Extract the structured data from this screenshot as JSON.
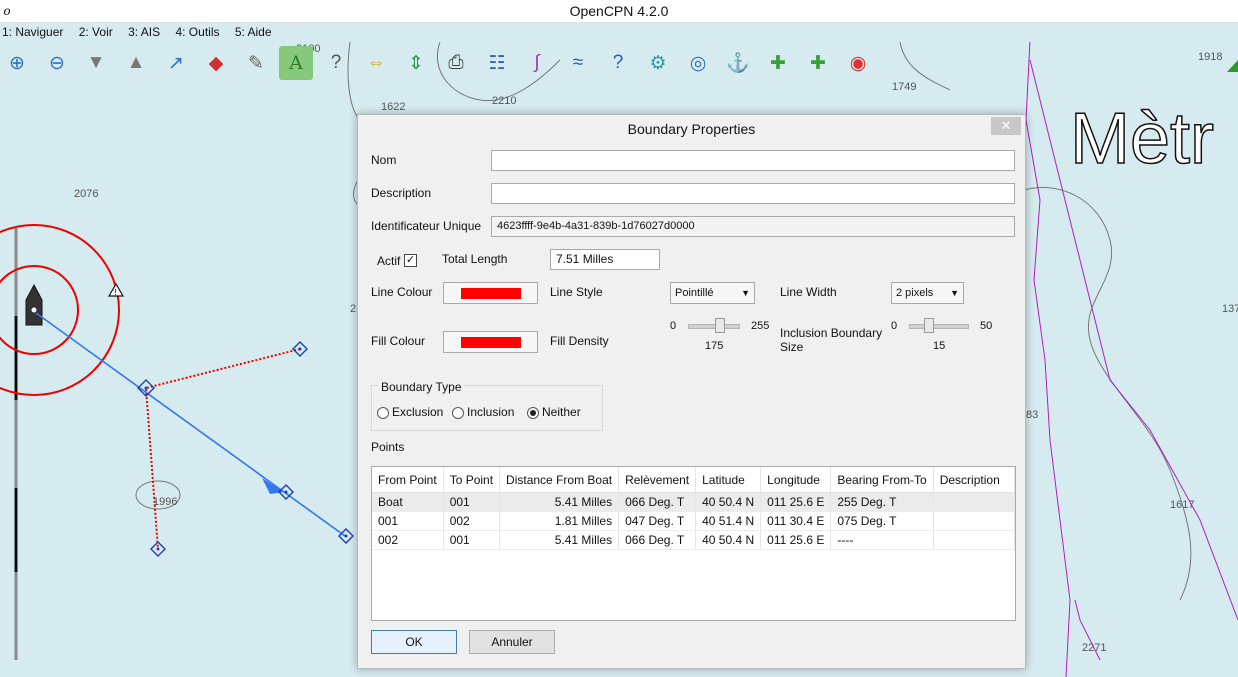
{
  "window": {
    "title": "OpenCPN 4.2.0",
    "icon_letter": "o"
  },
  "menu": [
    "1: Naviguer",
    "2: Voir",
    "3: AIS",
    "4: Outils",
    "5: Aide"
  ],
  "toolbar": {
    "icons": [
      "zoom-in-icon",
      "zoom-out-icon",
      "scale-down-icon",
      "scale-up-icon",
      "route-icon",
      "ship-tracking-icon",
      "tools-icon",
      "text-tool-icon",
      "query-icon",
      "chart-quilt-icon",
      "follow-icon",
      "print-icon",
      "route-manager-icon",
      "track-icon",
      "tide-icon",
      "help-icon",
      "settings-icon",
      "mob-icon",
      "plugin-icon",
      "plugin2-icon",
      "plugin3-icon",
      "lifebuoy-icon"
    ],
    "active_index": 7
  },
  "map": {
    "soundings": [
      "2100",
      "1622",
      "2210",
      "1749",
      "1918",
      "2076",
      "2",
      "1996",
      "137",
      "83",
      "1617",
      "2271"
    ],
    "big_label": "Mètr"
  },
  "dialog": {
    "title": "Boundary Properties",
    "close_label": "✕",
    "name_label": "Nom",
    "name_value": "",
    "description_label": "Description",
    "description_value": "",
    "guid_label": "Identificateur Unique",
    "guid_value": "4623ffff-9e4b-4a31-839b-1d76027d0000",
    "active_label": "Actif",
    "active_checked": true,
    "total_length_label": "Total Length",
    "total_length_value": "7.51 Milles",
    "line_colour_label": "Line Colour",
    "line_colour": "#ff0000",
    "line_style_label": "Line Style",
    "line_style_value": "Pointillé",
    "line_width_label": "Line Width",
    "line_width_value": "2 pixels",
    "fill_colour_label": "Fill Colour",
    "fill_colour": "#ff0000",
    "fill_density_label": "Fill Density",
    "fill_density": {
      "min": "0",
      "max": "255",
      "value": "175"
    },
    "inclusion_size_label": "Inclusion Boundary Size",
    "inclusion_size": {
      "min": "0",
      "max": "50",
      "value": "15"
    },
    "boundary_type_label": "Boundary Type",
    "boundary_types": [
      {
        "label": "Exclusion",
        "checked": false
      },
      {
        "label": "Inclusion",
        "checked": false
      },
      {
        "label": "Neither",
        "checked": true
      }
    ],
    "points_label": "Points",
    "points_columns": [
      "From Point",
      "To Point",
      "Distance From Boat",
      "Relèvement",
      "Latitude",
      "Longitude",
      "Bearing From-To",
      "Description"
    ],
    "points_rows": [
      [
        "Boat",
        "001",
        "5.41 Milles",
        "066 Deg. T",
        "40 50.4 N",
        "011 25.6 E",
        "255 Deg. T",
        ""
      ],
      [
        "001",
        "002",
        "1.81 Milles",
        "047 Deg. T",
        "40 51.4 N",
        "011 30.4 E",
        "075 Deg. T",
        ""
      ],
      [
        "002",
        "001",
        "5.41 Milles",
        "066 Deg. T",
        "40 50.4 N",
        "011 25.6 E",
        "----",
        ""
      ]
    ],
    "ok_label": "OK",
    "cancel_label": "Annuler"
  }
}
